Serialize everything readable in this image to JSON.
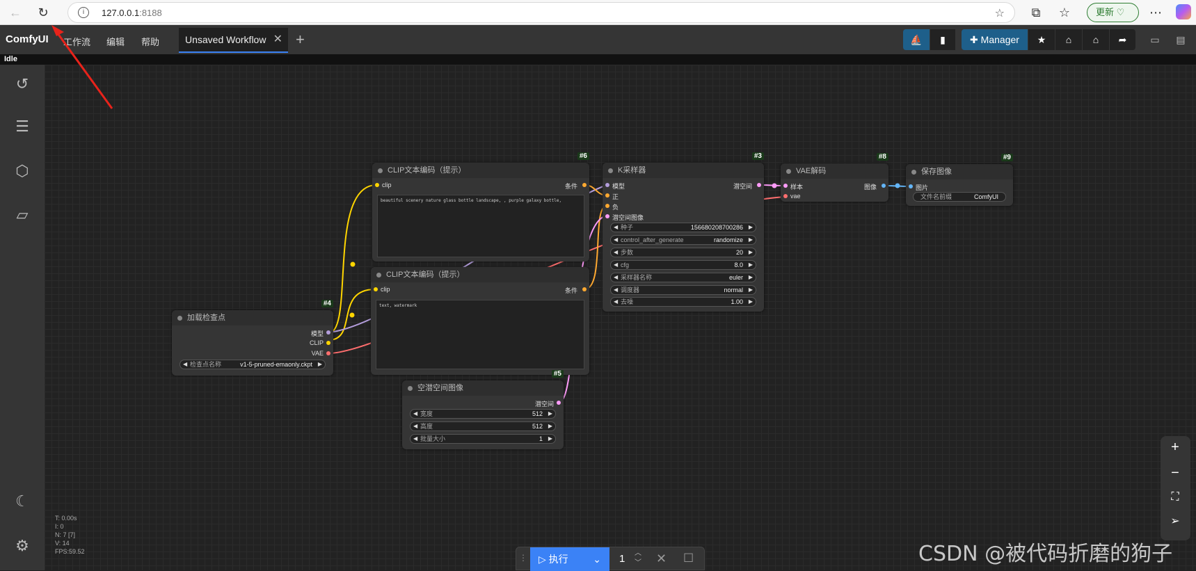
{
  "browser": {
    "url_host": "127.0.0.1",
    "url_port": ":8188",
    "update_label": "更新"
  },
  "app": {
    "logo": "ComfyUI",
    "menus": [
      "工作流",
      "编辑",
      "帮助"
    ],
    "tab_title": "Unsaved Workflow",
    "manager_label": "Manager",
    "status": "Idle"
  },
  "nodes": {
    "clip_pos": {
      "id": "#6",
      "title": "CLIP文本编码（提示）",
      "input": "clip",
      "output": "条件",
      "text": "beautiful scenery nature glass bottle landscape, , purple galaxy bottle,"
    },
    "clip_neg": {
      "id": "",
      "title": "CLIP文本编码（提示）",
      "input": "clip",
      "output": "条件",
      "text": "text, watermark"
    },
    "ksampler": {
      "id": "#3",
      "title": "K采样器",
      "inputs": [
        "模型",
        "正",
        "负",
        "潜空间图像"
      ],
      "output": "潜空间",
      "widgets": [
        {
          "label": "种子",
          "value": "156680208700286"
        },
        {
          "label": "control_after_generate",
          "value": "randomize"
        },
        {
          "label": "步数",
          "value": "20"
        },
        {
          "label": "cfg",
          "value": "8.0"
        },
        {
          "label": "采样器名称",
          "value": "euler"
        },
        {
          "label": "调度器",
          "value": "normal"
        },
        {
          "label": "去噪",
          "value": "1.00"
        }
      ]
    },
    "vae_decode": {
      "id": "#8",
      "title": "VAE解码",
      "inputs": [
        "样本",
        "vae"
      ],
      "output": "图像"
    },
    "save_image": {
      "id": "#9",
      "title": "保存图像",
      "input": "图片",
      "widget_label": "文件名前缀",
      "widget_value": "ComfyUI"
    },
    "checkpoint": {
      "id": "#4",
      "title": "加载检查点",
      "outputs": [
        "模型",
        "CLIP",
        "VAE"
      ],
      "widget_label": "检查点名称",
      "widget_value": "v1-5-pruned-emaonly.ckpt"
    },
    "empty_latent": {
      "id": "#5",
      "title": "空潜空间图像",
      "output": "潜空间",
      "widgets": [
        {
          "label": "宽度",
          "value": "512"
        },
        {
          "label": "高度",
          "value": "512"
        },
        {
          "label": "批量大小",
          "value": "1"
        }
      ]
    }
  },
  "stats": [
    "T: 0.00s",
    "I: 0",
    "N: 7 [7]",
    "V: 14",
    "FPS:59.52"
  ],
  "run": {
    "label": "执行",
    "count": "1"
  },
  "watermark": "CSDN @被代码折磨的狗子",
  "colors": {
    "accent": "#3b82f6",
    "clip_wire": "#ffd500",
    "model_wire": "#b39ddb",
    "vae_wire": "#ff6e6e",
    "cond_wire": "#ffa931",
    "latent_wire": "#ff9cf9",
    "image_wire": "#64b5f6"
  }
}
